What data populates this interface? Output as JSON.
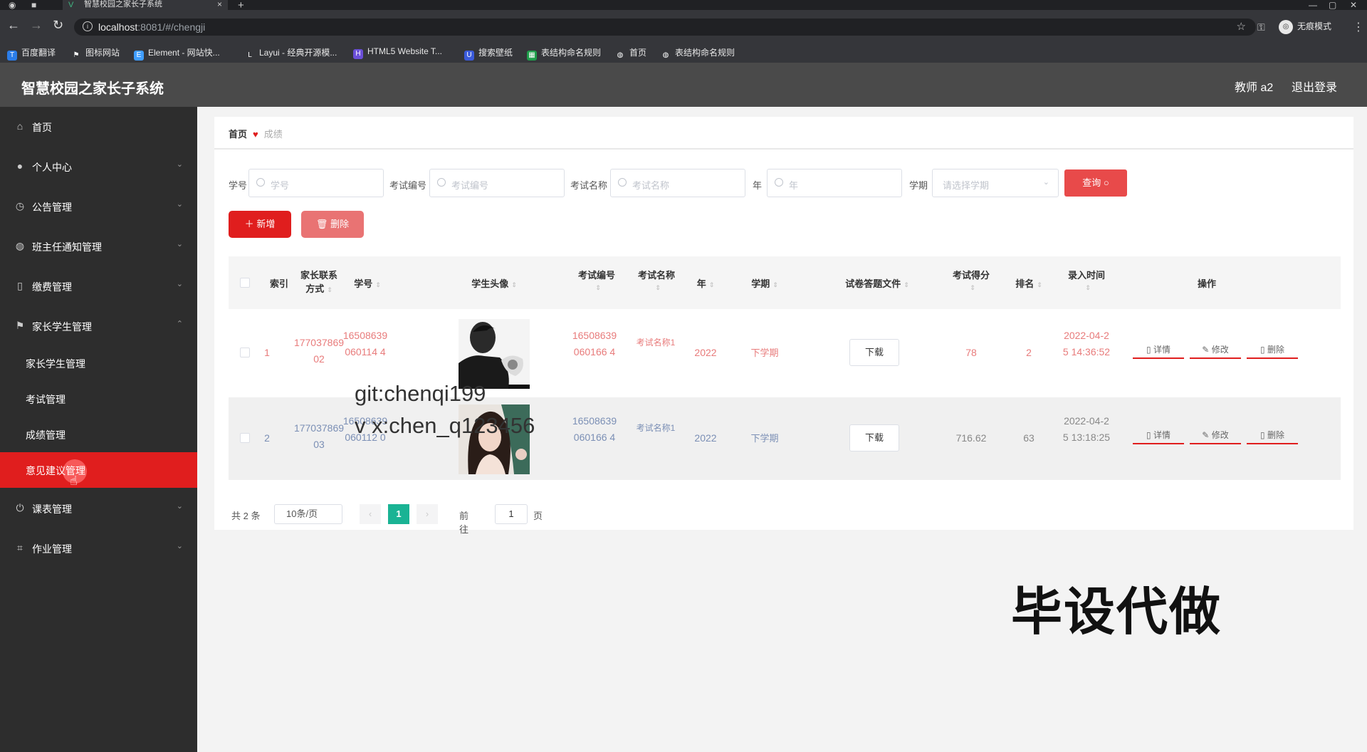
{
  "browser": {
    "tab_title": "智慧校园之家长子系统",
    "url_host": "localhost",
    "url_path": ":8081/#/chengji",
    "profile_label": "无痕模式",
    "bookmarks": [
      "百度翻译",
      "图标网站",
      "Element - 网站快...",
      "Layui - 经典开源模...",
      "HTML5 Website T...",
      "搜索壁纸",
      "表结构命名规则",
      "首页",
      "表结构命名规则"
    ]
  },
  "header": {
    "title": "智慧校园之家长子系统",
    "user": "教师 a2",
    "logout": "退出登录"
  },
  "sidebar": {
    "items": [
      {
        "label": "首页"
      },
      {
        "label": "个人中心"
      },
      {
        "label": "公告管理"
      },
      {
        "label": "班主任通知管理"
      },
      {
        "label": "缴费管理"
      },
      {
        "label": "家长学生管理"
      },
      {
        "label": "课表管理"
      },
      {
        "label": "作业管理"
      }
    ],
    "sub_items": [
      {
        "label": "家长学生管理"
      },
      {
        "label": "考试管理"
      },
      {
        "label": "成绩管理"
      },
      {
        "label": "意见建议管理"
      }
    ]
  },
  "breadcrumb": {
    "home": "首页",
    "current": "成绩"
  },
  "filters": {
    "student_no_label": "学号",
    "student_no_placeholder": "学号",
    "exam_no_label": "考试编号",
    "exam_no_placeholder": "考试编号",
    "exam_name_label": "考试名称",
    "exam_name_placeholder": "考试名称",
    "year_label": "年",
    "year_placeholder": "年",
    "term_label": "学期",
    "term_placeholder": "请选择学期",
    "query_label": "查询"
  },
  "actions": {
    "add_label": "新增",
    "delete_label": "删除"
  },
  "table": {
    "headers": {
      "index": "索引",
      "parent_contact_line1": "家长联系",
      "parent_contact_line2": "方式",
      "student_no": "学号",
      "avatar": "学生头像",
      "exam_no": "考试编号",
      "exam_name": "考试名称",
      "year": "年",
      "term": "学期",
      "file": "试卷答题文件",
      "score": "考试得分",
      "rank": "排名",
      "entry_time": "录入时间",
      "operation": "操作"
    },
    "rows": [
      {
        "index": "1",
        "contact": "17703786902",
        "student_no": "16508639060114 4",
        "exam_no": "16508639060166 4",
        "exam_name": "考试名称1",
        "year": "2022",
        "term": "下学期",
        "download": "下载",
        "score": "78",
        "rank": "2",
        "time": "2022-04-25 14:36:52",
        "detail": "详情",
        "edit": "修改",
        "del": "删除"
      },
      {
        "index": "2",
        "contact": "17703786903",
        "student_no": "16508639060112 0",
        "exam_no": "16508639060166 4",
        "exam_name": "考试名称1",
        "year": "2022",
        "term": "下学期",
        "download": "下载",
        "score": "716.62",
        "rank": "63",
        "time": "2022-04-25 13:18:25",
        "detail": "详情",
        "edit": "修改",
        "del": "删除"
      }
    ]
  },
  "pagination": {
    "total": "共 2 条",
    "page_size": "10条/页",
    "current": "1",
    "goto": "前往",
    "goto_value": "1",
    "page_unit": "页"
  },
  "watermarks": {
    "line1": "git:chenqi199",
    "line2": "v x:chen_q123456",
    "big": "毕设代做"
  },
  "colors": {
    "accent": "#e01e1e",
    "sidebar_bg": "#2d2d2d",
    "header_bg": "#4a4a4a",
    "pager_active": "#1ab394"
  }
}
